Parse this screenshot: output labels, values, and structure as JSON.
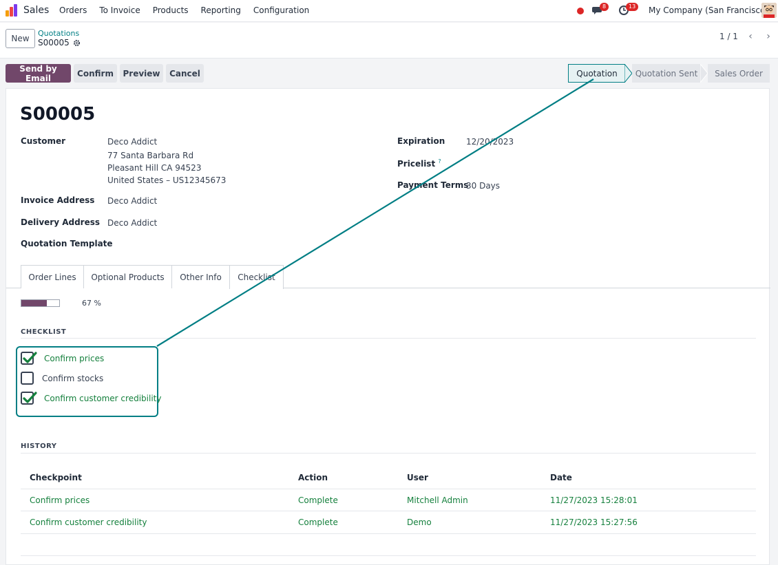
{
  "nav": {
    "app_name": "Sales",
    "items": [
      "Orders",
      "To Invoice",
      "Products",
      "Reporting",
      "Configuration"
    ],
    "messages_badge": "8",
    "activities_badge": "13",
    "company": "My Company (San Francisco)"
  },
  "control": {
    "new_label": "New",
    "breadcrumb": "Quotations",
    "record": "S00005",
    "pager": "1 / 1"
  },
  "actions": {
    "send_email": "Send by Email",
    "confirm": "Confirm",
    "preview": "Preview",
    "cancel": "Cancel"
  },
  "stages": [
    "Quotation",
    "Quotation Sent",
    "Sales Order"
  ],
  "form": {
    "title": "S00005",
    "customer_label": "Customer",
    "customer_name": "Deco Addict",
    "address_line1": "77 Santa Barbara Rd",
    "address_line2": "Pleasant Hill CA 94523",
    "address_line3": "United States – US12345673",
    "invoice_label": "Invoice Address",
    "invoice_value": "Deco Addict",
    "delivery_label": "Delivery Address",
    "delivery_value": "Deco Addict",
    "template_label": "Quotation Template",
    "expiration_label": "Expiration",
    "expiration_value": "12/20/2023",
    "pricelist_label": "Pricelist",
    "pricelist_help": "?",
    "terms_label": "Payment Terms",
    "terms_value": "30 Days"
  },
  "tabs": [
    "Order Lines",
    "Optional Products",
    "Other Info",
    "Checklist"
  ],
  "checklist": {
    "progress_value": 67,
    "progress_text": "67 %",
    "section_title": "CHECKLIST",
    "items": [
      {
        "label": "Confirm prices",
        "checked": true
      },
      {
        "label": "Confirm stocks",
        "checked": false
      },
      {
        "label": "Confirm customer credibility",
        "checked": true
      }
    ]
  },
  "history": {
    "section_title": "HISTORY",
    "columns": [
      "Checkpoint",
      "Action",
      "User",
      "Date"
    ],
    "rows": [
      {
        "checkpoint": "Confirm prices",
        "action": "Complete",
        "user": "Mitchell Admin",
        "date": "11/27/2023 15:28:01"
      },
      {
        "checkpoint": "Confirm customer credibility",
        "action": "Complete",
        "user": "Demo",
        "date": "11/27/2023 15:27:56"
      }
    ]
  },
  "colors": {
    "brand": "#71476a",
    "accent": "#017e84",
    "done": "#15803d"
  }
}
